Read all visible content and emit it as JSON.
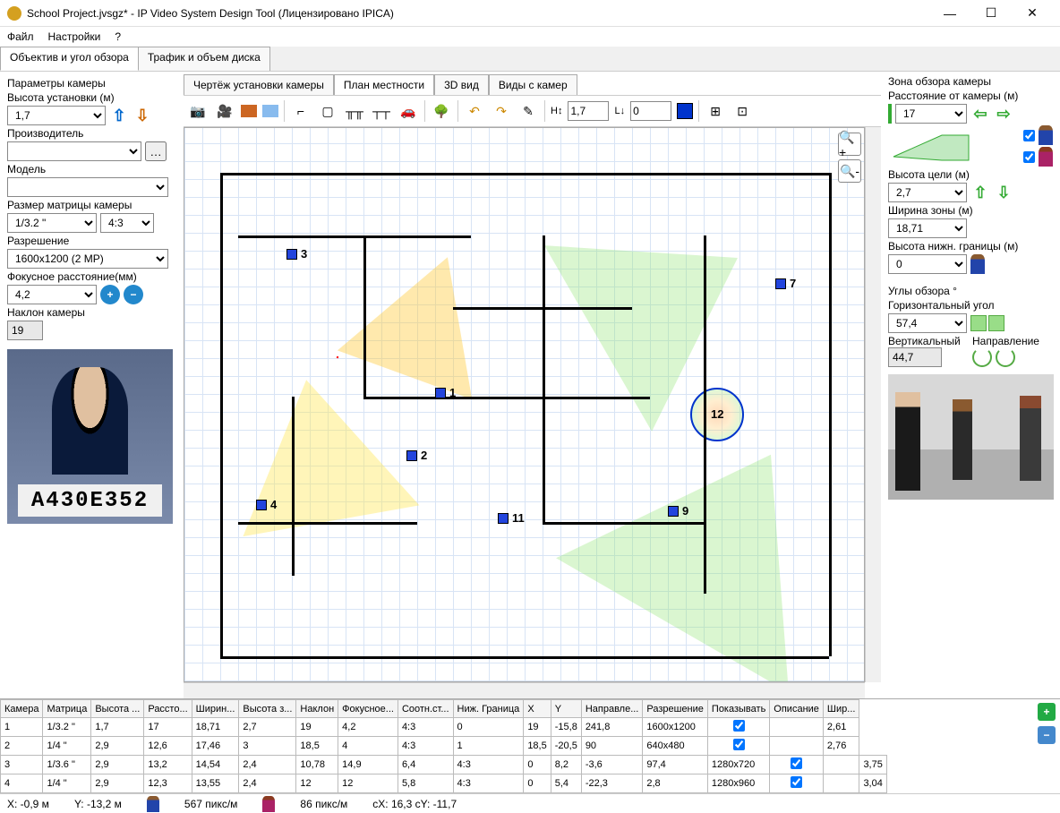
{
  "window": {
    "title": "School Project.jvsgz* - IP Video System Design Tool (Лицензировано  IPICA)"
  },
  "menu": [
    "Файл",
    "Настройки",
    "?"
  ],
  "top_tabs": [
    "Объектив и угол обзора",
    "Трафик и объем диска"
  ],
  "top_tabs_active": 0,
  "left": {
    "section": "Параметры камеры",
    "height_label": "Высота установки (м)",
    "height": "1,7",
    "manufacturer_label": "Производитель",
    "manufacturer": "",
    "model_label": "Модель",
    "model": "",
    "sensor_label": "Размер матрицы камеры",
    "sensor": "1/3.2 \"",
    "sensor_ratio": "4:3",
    "resolution_label": "Разрешение",
    "resolution": "1600x1200 (2 MP)",
    "focal_label": "Фокусное расстояние(мм)",
    "focal": "4,2",
    "tilt_label": "Наклон камеры",
    "tilt": "19",
    "plate": "A430E352"
  },
  "center_tabs": [
    "Чертёж установки камеры",
    "План местности",
    "3D вид",
    "Виды с камер"
  ],
  "center_tabs_active": 1,
  "toolbar": {
    "height": "1,7",
    "length": "0",
    "camera_labels": [
      "1",
      "2",
      "3",
      "4",
      "7",
      "9",
      "11",
      "12"
    ]
  },
  "right": {
    "section1": "Зона обзора камеры",
    "distance_label": "Расстояние от камеры (м)",
    "distance": "17",
    "target_height_label": "Высота цели (м)",
    "target_height": "2,7",
    "zone_width_label": "Ширина зоны (м)",
    "zone_width": "18,71",
    "lower_bound_label": "Высота нижн. границы (м)",
    "lower_bound": "0",
    "section2": "Углы обзора °",
    "horiz_label": "Горизонтальный угол",
    "horiz": "57,4",
    "vert_label": "Вертикальный",
    "vert": "44,7",
    "direction_label": "Направление"
  },
  "table": {
    "headers": [
      "Камера",
      "Матрица",
      "Высота ...",
      "Рассто...",
      "Ширин...",
      "Высота з...",
      "Наклон",
      "Фокусное...",
      "Соотн.ст...",
      "Ниж. Граница",
      "X",
      "Y",
      "Направле...",
      "Разрешение",
      "Показывать",
      "Описание",
      "Шир..."
    ],
    "rows": [
      [
        "1",
        "1/3.2 \"",
        "1,7",
        "17",
        "18,71",
        "2,7",
        "19",
        "4,2",
        "4:3",
        "0",
        "19",
        "-15,8",
        "241,8",
        "1600x1200",
        true,
        "",
        "2,61"
      ],
      [
        "2",
        "1/4 \"",
        "2,9",
        "12,6",
        "17,46",
        "3",
        "18,5",
        "4",
        "4:3",
        "1",
        "18,5",
        "-20,5",
        "90",
        "640x480",
        true,
        "",
        "2,76"
      ],
      [
        "3",
        "1/3.6 \"",
        "2,9",
        "13,2",
        "14,54",
        "2,4",
        "10,78",
        "14,9",
        "6,4",
        "4:3",
        "0",
        "8,2",
        "-3,6",
        "97,4",
        "1280x720",
        true,
        "",
        "3,75"
      ],
      [
        "4",
        "1/4 \"",
        "2,9",
        "12,3",
        "13,55",
        "2,4",
        "12",
        "12",
        "5,8",
        "4:3",
        "0",
        "5,4",
        "-22,3",
        "2,8",
        "1280x960",
        true,
        "",
        "3,04"
      ]
    ]
  },
  "status": {
    "x": "X: -0,9 м",
    "y": "Y: -13,2 м",
    "px1": "567 пикс/м",
    "px2": "86 пикс/м",
    "c": "cX: 16,3 cY: -11,7"
  }
}
